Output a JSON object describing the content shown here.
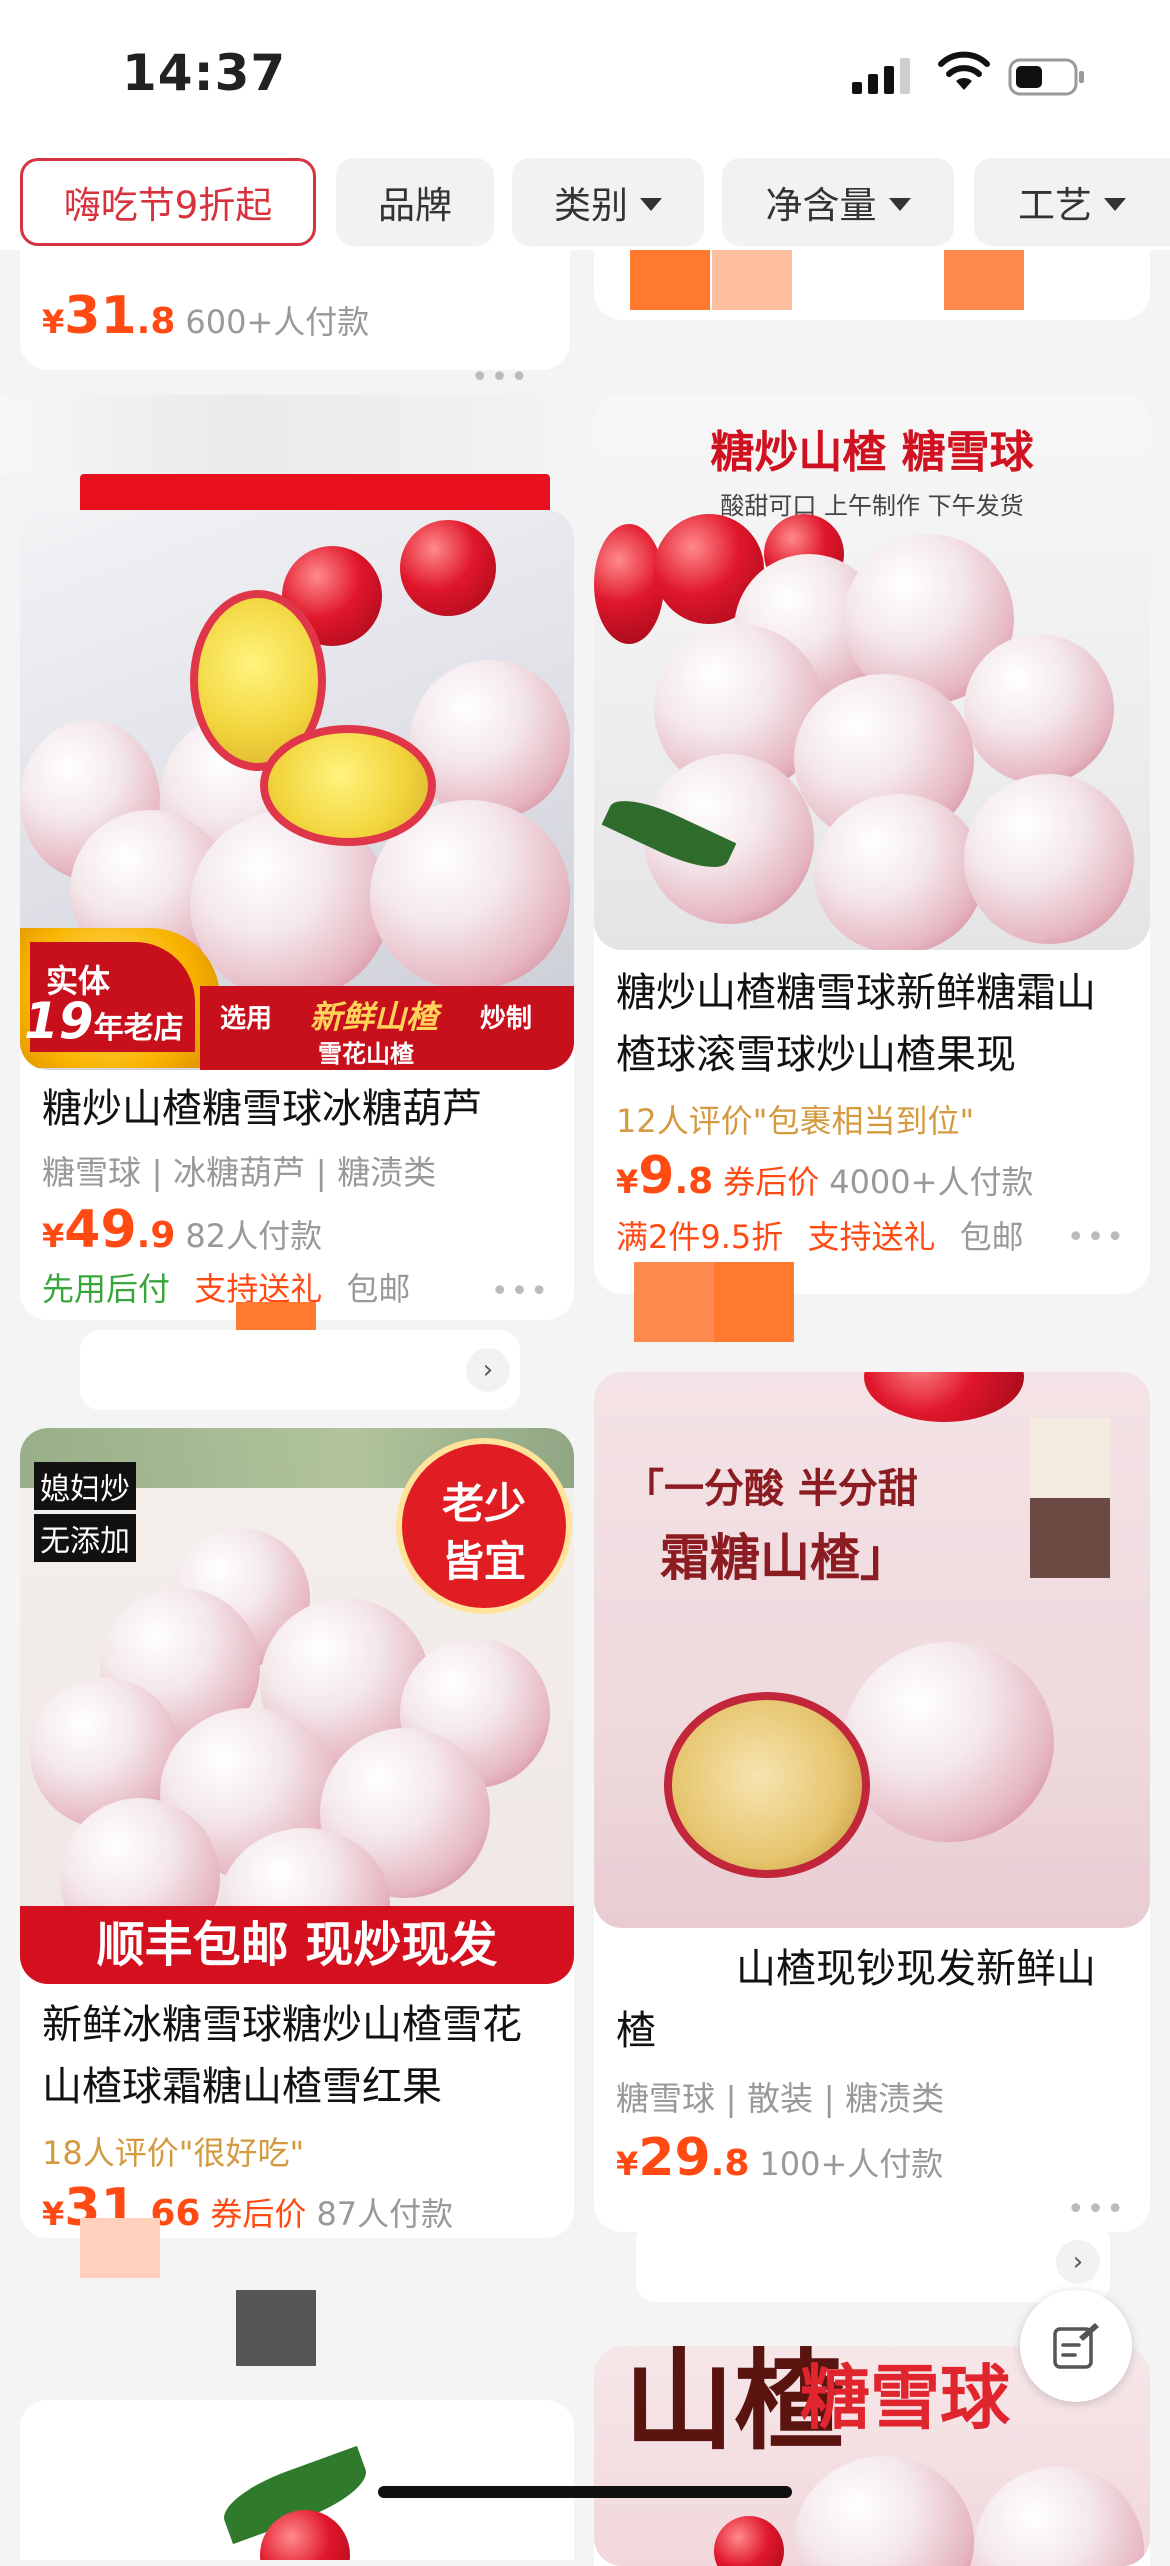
{
  "status_bar": {
    "time": "14:37"
  },
  "filters": {
    "promo": "嗨吃节9折起",
    "brand": "品牌",
    "category": "类别",
    "net_weight": "净含量",
    "craft": "工艺"
  },
  "top_partial": {
    "price_currency": "¥",
    "price_int": "31",
    "price_dec": ".8",
    "paid": "600+人付款"
  },
  "products": [
    {
      "image_texts": {
        "badge_top": "实体",
        "badge_num": "19",
        "badge_tail": "年老店",
        "band_left": "选用",
        "band_mid": "新鲜山楂",
        "band_right": "炒制",
        "band_sub": "雪花山楂"
      },
      "title": "糖炒山楂糖雪球冰糖葫芦",
      "tags": "糖雪球 | 冰糖葫芦 | 糖渍类",
      "price_int": "49",
      "price_dec": ".9",
      "paid": "82人付款",
      "promo_green": "先用后付",
      "promo_orange": "支持送礼",
      "promo_gray": "包邮"
    },
    {
      "image_texts": {
        "headline": "糖炒山楂  糖雪球",
        "sub": "酸甜可口  上午制作  下午发货"
      },
      "title": "糖炒山楂糖雪球新鲜糖霜山楂球滚雪球炒山楂果现",
      "review": "12人评价\"包裹相当到位\"",
      "price_int": "9",
      "price_dec": ".8",
      "after_coupon": "券后价",
      "paid": "4000+人付款",
      "promo_orange1": "满2件9.5折",
      "promo_orange2": "支持送礼",
      "promo_gray": "包邮"
    },
    {
      "image_texts": {
        "tag1": "媳妇炒",
        "tag2": "无添加",
        "seal1": "老少",
        "seal2": "皆宜",
        "band": "顺丰包邮   现炒现发"
      },
      "title": "新鲜冰糖雪球糖炒山楂雪花山楂球霜糖山楂雪红果",
      "review": "18人评价\"很好吃\"",
      "price_int": "31",
      "price_dec": ".66",
      "after_coupon": "券后价",
      "paid": "87人付款"
    },
    {
      "image_texts": {
        "line1": "「一分酸 半分甜",
        "line2": "霜糖山楂」"
      },
      "title": "山楂现钞现发新鲜山楂",
      "tags": "糖雪球 | 散装 | 糖渍类",
      "price_int": "29",
      "price_dec": ".8",
      "paid": "100+人付款"
    },
    {
      "image_texts": {
        "headline": "糖雪球",
        "brush": "山楂"
      }
    }
  ],
  "colors": {
    "accent_red": "#d8323e",
    "price_orange": "#ff4a13",
    "green": "#38a63b",
    "review_gold": "#d49a3f"
  },
  "icons": [
    "signal-icon",
    "wifi-icon",
    "battery-icon",
    "caret-down-icon",
    "more-dots-icon",
    "chevron-right-icon",
    "feedback-edit-icon"
  ]
}
